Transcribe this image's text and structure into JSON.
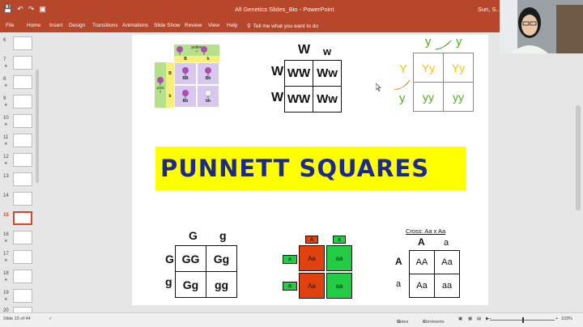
{
  "window": {
    "title": "All Genetics Slides_Bio  -  PowerPoint",
    "user": "Sun, S..."
  },
  "ribbon": {
    "tabs": [
      "File",
      "Home",
      "Insert",
      "Design",
      "Transitions",
      "Animations",
      "Slide Show",
      "Review",
      "View",
      "Help"
    ],
    "tell_me": "Tell me what you want to do"
  },
  "thumbnails": {
    "numbers": [
      "6",
      "7",
      "8",
      "9",
      "10",
      "11",
      "12",
      "13",
      "14",
      "15",
      "16",
      "17",
      "18",
      "19",
      "20"
    ],
    "active": "15"
  },
  "slide": {
    "title": "PUNNETT SQUARES",
    "pollen_square": {
      "top_label": "pollen",
      "top_symbol": "♂",
      "side_label": "pistil",
      "side_symbol": "♀",
      "col_headers": [
        "B",
        "b"
      ],
      "row_headers": [
        "B",
        "b"
      ],
      "cells": [
        [
          "BB",
          "Bb"
        ],
        [
          "Bb",
          "bb"
        ]
      ]
    },
    "w_square": {
      "col_headers": [
        "W",
        "w"
      ],
      "row_headers": [
        "W",
        "W"
      ],
      "cells": [
        [
          "WW",
          "Ww"
        ],
        [
          "WW",
          "Ww"
        ]
      ]
    },
    "y_square": {
      "col_headers": [
        "y",
        "y"
      ],
      "row_headers": [
        "Y",
        "y"
      ],
      "cells": [
        [
          "Yy",
          "Yy"
        ],
        [
          "yy",
          "yy"
        ]
      ]
    },
    "g_square": {
      "col_headers": [
        "G",
        "g"
      ],
      "row_headers": [
        "G",
        "g"
      ],
      "cells": [
        [
          "GG",
          "Gg"
        ],
        [
          "Gg",
          "gg"
        ]
      ]
    },
    "a_square": {
      "col_headers": [
        "A",
        "a"
      ],
      "row_headers": [
        "a",
        "a"
      ],
      "cells": [
        [
          "Aa",
          "aa"
        ],
        [
          "Aa",
          "aa"
        ]
      ]
    },
    "cross_square": {
      "caption": "Cross: Aa x Aa",
      "col_headers": [
        "A",
        "a"
      ],
      "row_headers": [
        "A",
        "a"
      ],
      "cells": [
        [
          "AA",
          "Aa"
        ],
        [
          "Aa",
          "aa"
        ]
      ]
    }
  },
  "status": {
    "slide_count": "Slide 15 of 44",
    "notes": "Notes",
    "comments": "Comments",
    "zoom": "103%"
  },
  "colors": {
    "ribbon": "#b7472a",
    "banner_bg": "#ffff00",
    "banner_text": "#1c2a8c",
    "dominant_cell": "#e0420f",
    "recessive_cell": "#22cc44",
    "banana_yellow": "#f6c200",
    "y_green": "#4caf1a"
  }
}
